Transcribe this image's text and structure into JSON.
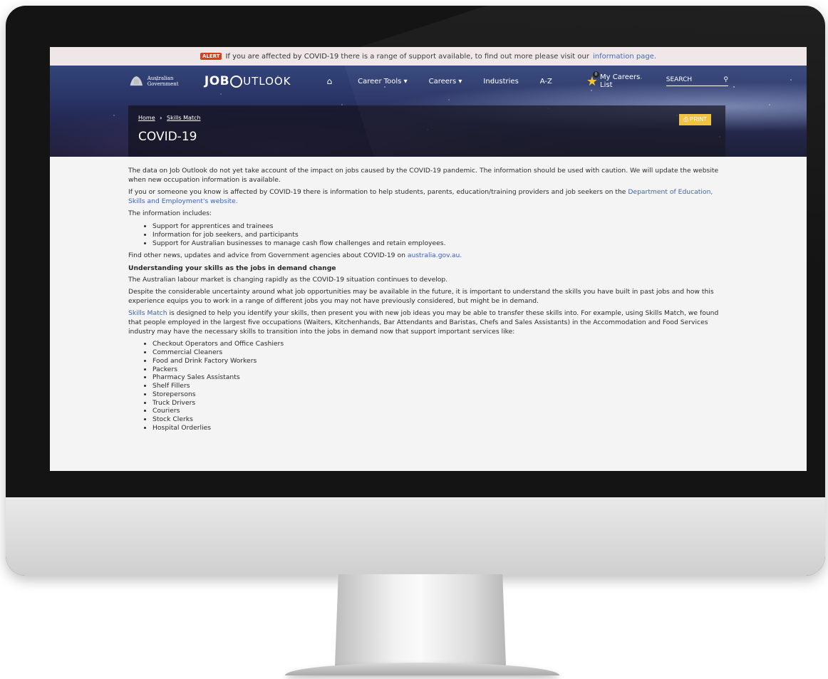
{
  "alert": {
    "badge": "ALERT",
    "text": "If you are affected by COVID-19 there is a range of support available, to find out more please visit our",
    "link": "information page."
  },
  "nav": {
    "gov_label": "Australian Government",
    "logo_job": "JOB",
    "logo_outlook": "UTLOOK",
    "items": [
      "Career Tools ▾",
      "Careers ▾",
      "Industries",
      "A-Z"
    ],
    "fav_count": "0",
    "fav_label": "My Careers List",
    "search_placeholder": "SEARCH"
  },
  "banner": {
    "breadcrumb": [
      "Home",
      "Skills Match"
    ],
    "title": "COVID-19",
    "print_label": "PRINT"
  },
  "content": {
    "p1": "The data on Job Outlook do not yet take account of the impact on jobs caused by the COVID-19 pandemic. The information should be used with caution. We will update the website when new occupation information is available.",
    "p2_text": "If you or someone you know is affected by COVID-19 there is information to help students, parents, education/training providers and job seekers on the",
    "p2_link": "Department of Education, Skills and Employment's website.",
    "p3": "The information includes:",
    "list1": [
      "Support for apprentices and trainees",
      "Information for job seekers, and participants",
      "Support for Australian businesses to manage cash flow challenges and retain employees."
    ],
    "p4_text": "Find other news, updates and advice from Government agencies about COVID-19 on",
    "p4_link": "australia.gov.au.",
    "heading": "Understanding your skills as the jobs in demand change",
    "p5": "The Australian labour market is changing rapidly as the COVID-19 situation continues to develop.",
    "p6": "Despite the considerable uncertainty around what job opportunities may be available in the future, it is important to understand the skills you have built in past jobs and how this experience equips you to work in a range of different jobs you may not have previously considered, but might be in demand.",
    "p7_link": "Skills Match",
    "p7_text": "is designed to help you identify your skills, then present you with new job ideas you may be able to transfer these skills into. For example, using Skills Match, we found that people employed in the largest five occupations (Waiters, Kitchenhands, Bar Attendants and Baristas, Chefs and Sales Assistants) in the Accommodation and Food Services industry may have the necessary skills to transition into the jobs in demand now that support important services like:",
    "list2": [
      "Checkout Operators and Office Cashiers",
      "Commercial Cleaners",
      "Food and Drink Factory Workers",
      "Packers",
      "Pharmacy Sales Assistants",
      "Shelf Fillers",
      "Storepersons",
      "Truck Drivers",
      "Couriers",
      "Stock Clerks",
      "Hospital Orderlies"
    ]
  },
  "colors": {
    "alert_badge": "#d9401a",
    "link": "#3c62b8",
    "print_button": "#f0c23a",
    "star": "#f1c232",
    "header": "#2a3467"
  }
}
